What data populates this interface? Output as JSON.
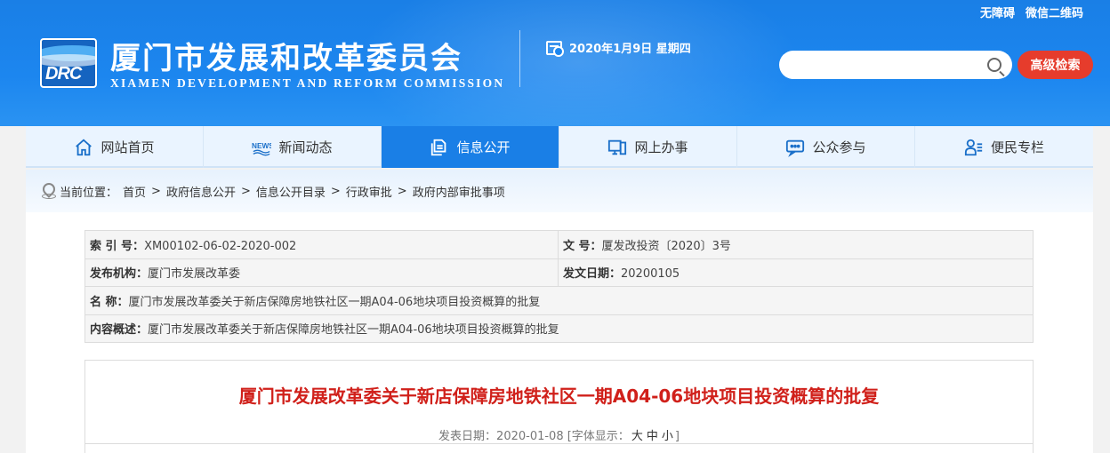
{
  "header": {
    "top_links": [
      "无障碍",
      "微信二维码"
    ],
    "logo_text": "DRC",
    "title": "厦门市发展和改革委员会",
    "subtitle": "XIAMEN DEVELOPMENT AND REFORM COMMISSION",
    "date": "2020年1月9日 星期四",
    "search": {
      "placeholder": "",
      "value": ""
    },
    "advanced_search_label": "高级检索"
  },
  "nav": {
    "items": [
      {
        "label": "网站首页",
        "icon": "home-icon",
        "active": false
      },
      {
        "label": "新闻动态",
        "icon": "news-icon",
        "active": false
      },
      {
        "label": "信息公开",
        "icon": "document-icon",
        "active": true
      },
      {
        "label": "网上办事",
        "icon": "online-service-icon",
        "active": false
      },
      {
        "label": "公众参与",
        "icon": "chat-icon",
        "active": false
      },
      {
        "label": "便民专栏",
        "icon": "user-list-icon",
        "active": false
      }
    ]
  },
  "breadcrumb": {
    "prefix": "当前位置：",
    "items": [
      "首页",
      "政府信息公开",
      "信息公开目录",
      "行政审批",
      "政府内部审批事项"
    ],
    "separator": ">"
  },
  "meta": {
    "index_label": "索 引 号：",
    "index_value": "XM00102-06-02-2020-002",
    "doc_no_label": "文 号：",
    "doc_no_value": "厦发改投资〔2020〕3号",
    "publisher_label": "发布机构：",
    "publisher_value": "厦门市发展改革委",
    "issue_date_label": "发文日期：",
    "issue_date_value": "20200105",
    "name_label": "名 称：",
    "name_value": "厦门市发展改革委关于新店保障房地铁社区一期A04-06地块项目投资概算的批复",
    "summary_label": "内容概述：",
    "summary_value": "厦门市发展改革委关于新店保障房地铁社区一期A04-06地块项目投资概算的批复"
  },
  "article": {
    "title": "厦门市发展改革委关于新店保障房地铁社区一期A04-06地块项目投资概算的批复",
    "publish_prefix": "发表日期：2020-01-08 [字体显示：",
    "font_large": "大",
    "font_medium": "中",
    "font_small": "小",
    "publish_suffix": "]"
  },
  "colors": {
    "header_blue": "#1c86ef",
    "active_nav": "#1a7fe6",
    "accent_red": "#e63c2c",
    "title_red": "#d0201a"
  }
}
